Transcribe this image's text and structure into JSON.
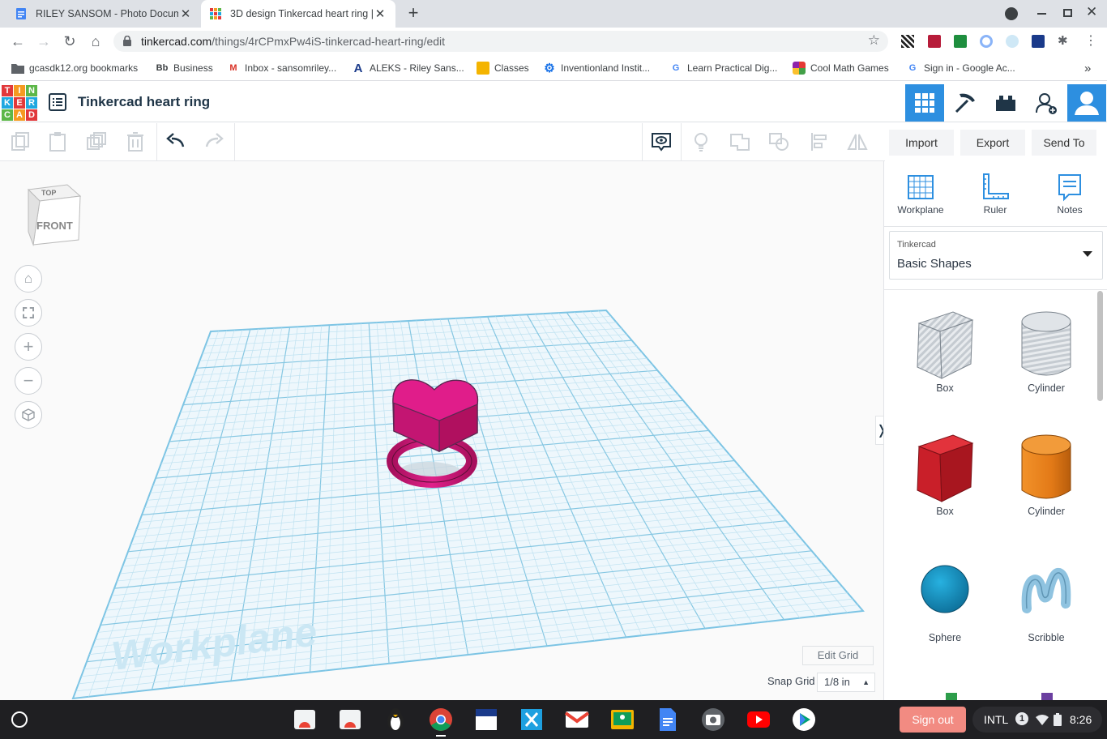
{
  "browser": {
    "tabs": [
      {
        "title": "RILEY SANSOM - Photo Documen",
        "active": false,
        "close": "✕"
      },
      {
        "title": "3D design Tinkercad heart ring |",
        "active": true,
        "close": "✕"
      }
    ],
    "new_tab": "+",
    "url_host": "tinkercad.com",
    "url_path": "/things/4rCPmxPw4iS-tinkercad-heart-ring/edit",
    "bookmarks": [
      {
        "label": "gcasdk12.org bookmarks",
        "icon": "folder-icon"
      },
      {
        "label": "Business",
        "icon": "blackboard-icon",
        "glyph": "Bb"
      },
      {
        "label": "Inbox - sansomriley...",
        "icon": "gmail-icon",
        "glyph": "M"
      },
      {
        "label": "ALEKS - Riley Sans...",
        "icon": "aleks-icon",
        "glyph": "A"
      },
      {
        "label": "Classes",
        "icon": "classroom-icon"
      },
      {
        "label": "Inventionland Instit...",
        "icon": "gear-icon"
      },
      {
        "label": "Learn Practical Dig...",
        "icon": "google-icon",
        "glyph": "G"
      },
      {
        "label": "Cool Math Games",
        "icon": "coolmath-icon"
      },
      {
        "label": "Sign in - Google Ac...",
        "icon": "google-icon",
        "glyph": "G"
      }
    ],
    "more_bookmarks": "»"
  },
  "tinkercad": {
    "logo_letters": [
      "T",
      "I",
      "N",
      "K",
      "E",
      "R",
      "C",
      "A",
      "D"
    ],
    "design_title": "Tinkercad heart ring",
    "actions": {
      "import": "Import",
      "export": "Export",
      "send_to": "Send To"
    },
    "viewcube": {
      "top": "TOP",
      "front": "FRONT"
    },
    "workplane_label": "Workplane",
    "edit_grid": "Edit Grid",
    "snap_grid_label": "Snap Grid",
    "snap_grid_value": "1/8 in",
    "panel_toggle": "❭",
    "panel_tools": [
      {
        "label": "Workplane",
        "icon": "workplane-icon"
      },
      {
        "label": "Ruler",
        "icon": "ruler-icon"
      },
      {
        "label": "Notes",
        "icon": "notes-icon"
      }
    ],
    "library": {
      "provider": "Tinkercad",
      "selected": "Basic Shapes"
    },
    "shapes": [
      {
        "label": "Box",
        "icon": "box-hole-icon"
      },
      {
        "label": "Cylinder",
        "icon": "cylinder-hole-icon"
      },
      {
        "label": "Box",
        "icon": "box-red-icon",
        "color": "#d0202a"
      },
      {
        "label": "Cylinder",
        "icon": "cylinder-orange-icon",
        "color": "#e37a17"
      },
      {
        "label": "Sphere",
        "icon": "sphere-icon",
        "color": "#1596c8"
      },
      {
        "label": "Scribble",
        "icon": "scribble-icon",
        "color": "#8fc3e0"
      }
    ]
  },
  "os": {
    "sign_out": "Sign out",
    "ime": "INTL",
    "notification_count": "1",
    "time": "8:26"
  },
  "colors": {
    "ring": "#d7187f",
    "accent_blue": "#2d8fe0",
    "grid": "#9ed3ea"
  }
}
